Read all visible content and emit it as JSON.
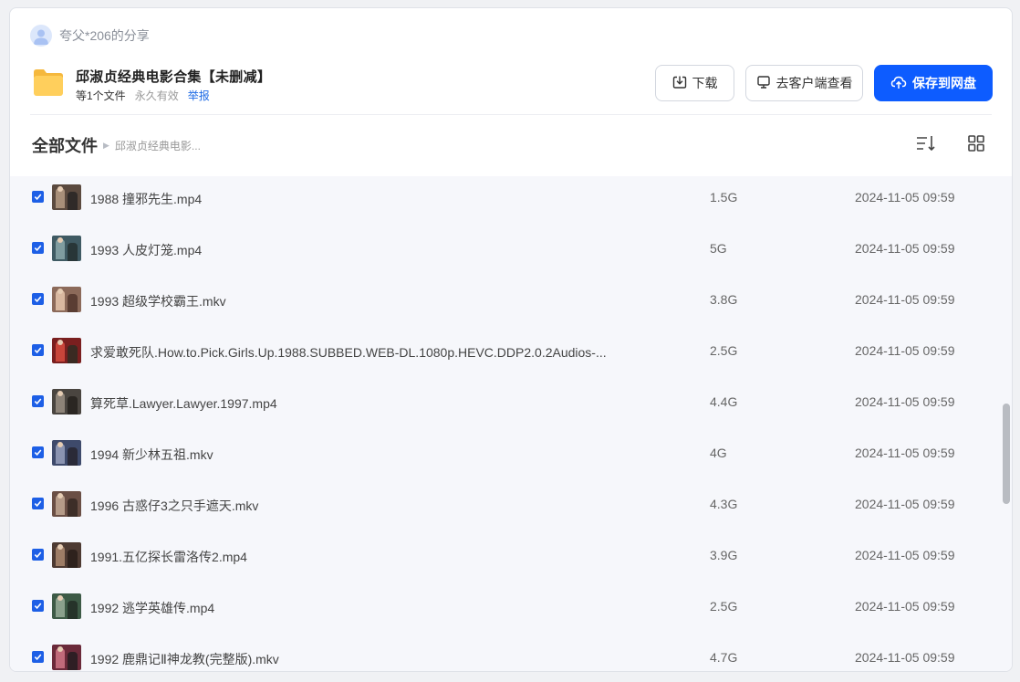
{
  "sharer": {
    "name": "夸父*206的分享",
    "avatar_icon": "user-avatar-icon"
  },
  "share": {
    "title": "邱淑贞经典电影合集【未删减】",
    "file_count": "等1个文件",
    "validity": "永久有效",
    "report": "举报",
    "folder_icon": "folder-icon"
  },
  "actions": {
    "download": "下载",
    "open_client": "去客户端查看",
    "save": "保存到网盘"
  },
  "breadcrumb": {
    "root": "全部文件",
    "current": "邱淑贞经典电影..."
  },
  "toolbar": {
    "sort_icon": "sort-icon",
    "view_icon": "grid-view-icon"
  },
  "colors": {
    "accent": "#0d5cff",
    "checkbox": "#1d5fe6",
    "link": "#1d6ae5"
  },
  "files": [
    {
      "name": "1988 撞邪先生.mp4",
      "size": "1.5G",
      "time": "2024-11-05 09:59",
      "checked": true
    },
    {
      "name": "1993 人皮灯笼.mp4",
      "size": "5G",
      "time": "2024-11-05 09:59",
      "checked": true
    },
    {
      "name": "1993 超级学校霸王.mkv",
      "size": "3.8G",
      "time": "2024-11-05 09:59",
      "checked": true
    },
    {
      "name": "求爱敢死队.How.to.Pick.Girls.Up.1988.SUBBED.WEB-DL.1080p.HEVC.DDP2.0.2Audios-...",
      "size": "2.5G",
      "time": "2024-11-05 09:59",
      "checked": true
    },
    {
      "name": "算死草.Lawyer.Lawyer.1997.mp4",
      "size": "4.4G",
      "time": "2024-11-05 09:59",
      "checked": true
    },
    {
      "name": "1994 新少林五祖.mkv",
      "size": "4G",
      "time": "2024-11-05 09:59",
      "checked": true
    },
    {
      "name": "1996 古惑仔3之只手遮天.mkv",
      "size": "4.3G",
      "time": "2024-11-05 09:59",
      "checked": true
    },
    {
      "name": "1991.五亿探长雷洛传2.mp4",
      "size": "3.9G",
      "time": "2024-11-05 09:59",
      "checked": true
    },
    {
      "name": "1992 逃学英雄传.mp4",
      "size": "2.5G",
      "time": "2024-11-05 09:59",
      "checked": true
    },
    {
      "name": "1992 鹿鼎记Ⅱ神龙教(完整版).mkv",
      "size": "4.7G",
      "time": "2024-11-05 09:59",
      "checked": true
    }
  ]
}
